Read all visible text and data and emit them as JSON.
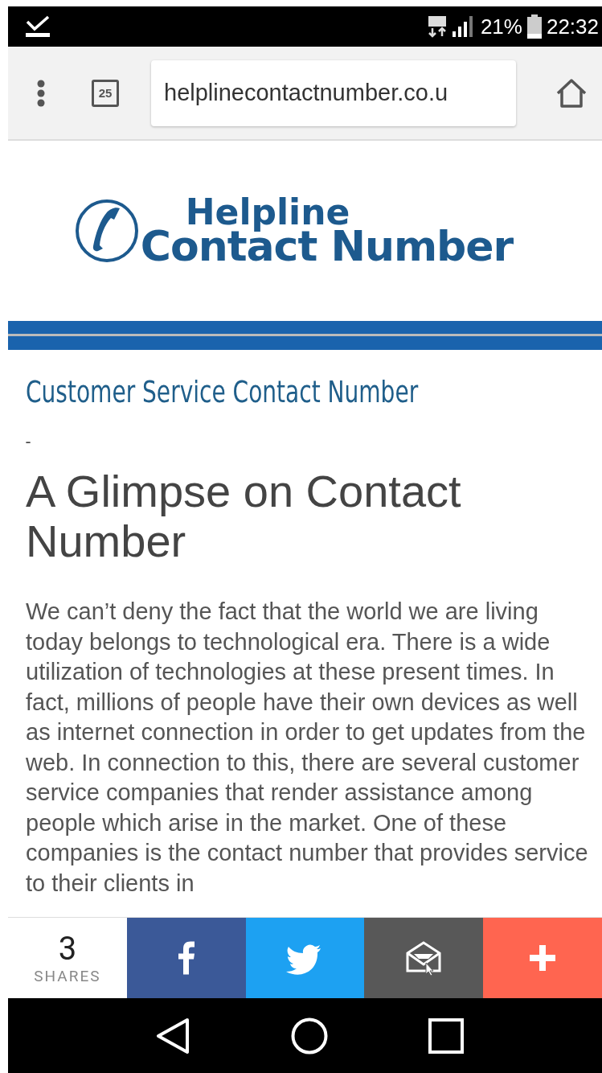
{
  "status_bar": {
    "battery": "21%",
    "time": "22:32"
  },
  "browser_toolbar": {
    "tab_count": "25",
    "url": "helplinecontactnumber.co.u"
  },
  "logo": {
    "line_1": "Helpline",
    "line_2": "Contact Number"
  },
  "article": {
    "category": "Customer Service Contact Number",
    "separator": "-",
    "title": "A Glimpse on Contact Number",
    "body": "We can’t deny the fact that the world we are living today belongs to technological era. There is a wide utilization of technologies at these present times. In fact, millions of people have their own devices as well as internet connection in order to get updates from the web. In connection to this, there are several customer service companies that render assistance among people which arise in the market. One of these companies is the contact number that provides service to their clients in"
  },
  "share_bar": {
    "count": "3",
    "count_label": "SHARES",
    "buttons": [
      {
        "kind": "facebook",
        "color": "#3b5998"
      },
      {
        "kind": "twitter",
        "color": "#1da1f2"
      },
      {
        "kind": "email",
        "color": "#585858"
      },
      {
        "kind": "more",
        "color": "#ff6550"
      }
    ]
  }
}
